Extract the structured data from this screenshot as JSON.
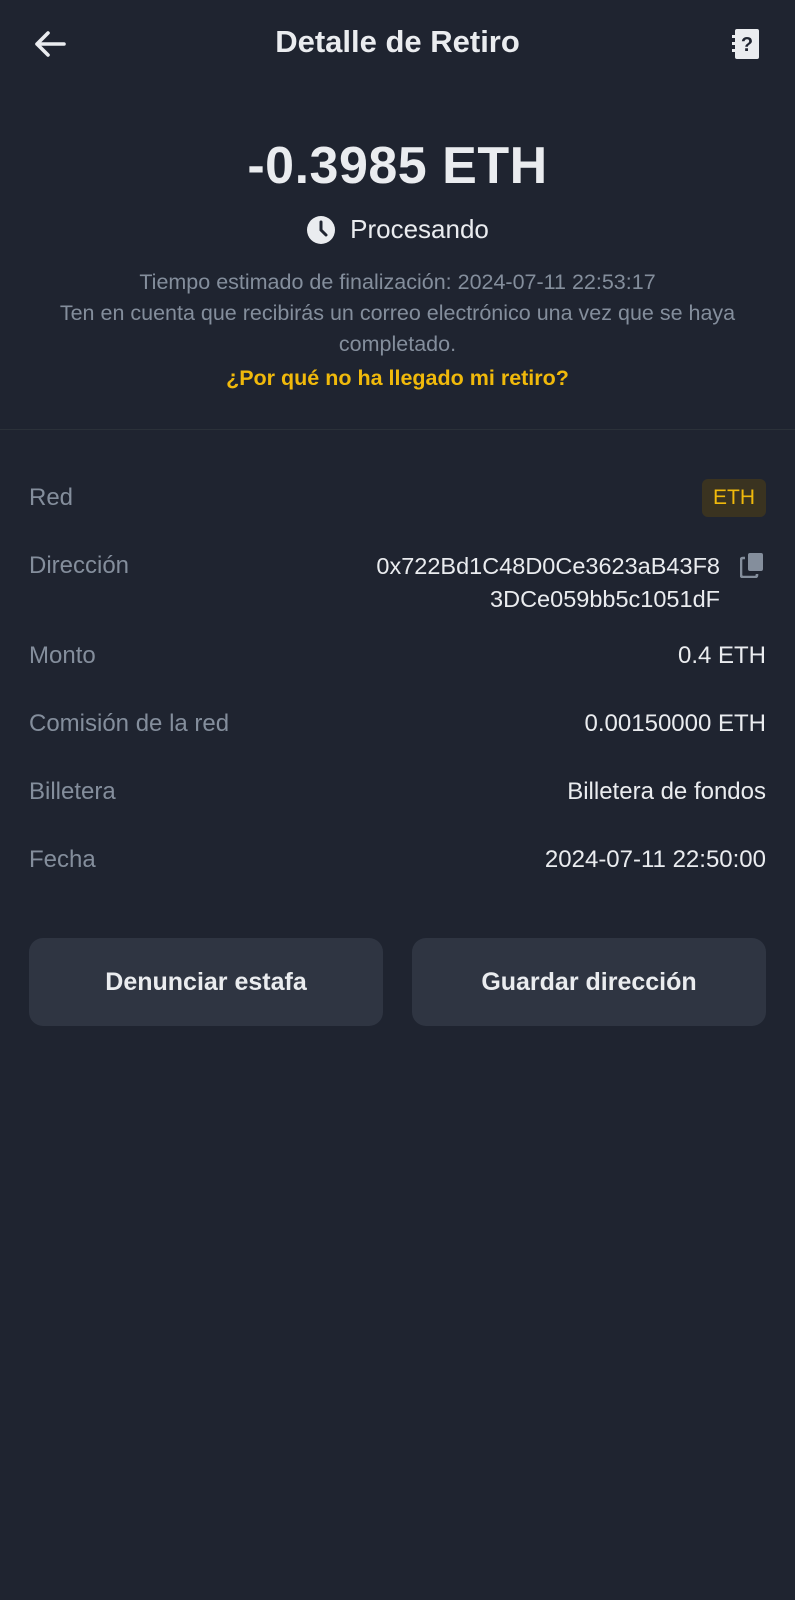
{
  "header": {
    "title": "Detalle de Retiro",
    "back_icon": "arrow-left-icon",
    "help_icon": "help-document-icon"
  },
  "hero": {
    "amount": "-0.3985 ETH",
    "status": "Procesando",
    "status_icon": "clock-icon",
    "estimated_time": "Tiempo estimado de finalización: 2024-07-11 22:53:17",
    "email_note": "Ten en cuenta que recibirás un correo electrónico una vez que se haya completado.",
    "why_link": "¿Por qué no ha llegado mi retiro?"
  },
  "details": {
    "network": {
      "label": "Red",
      "value": "ETH"
    },
    "address": {
      "label": "Dirección",
      "line1": "0x722Bd1C48D0Ce3623aB43F8",
      "line2": "3DCe059bb5c1051dF",
      "copy_icon": "copy-icon"
    },
    "amount": {
      "label": "Monto",
      "value": "0.4 ETH"
    },
    "fee": {
      "label": "Comisión de la red",
      "value": "0.00150000 ETH"
    },
    "wallet": {
      "label": "Billetera",
      "value": "Billetera de fondos"
    },
    "date": {
      "label": "Fecha",
      "value": "2024-07-11 22:50:00"
    }
  },
  "actions": {
    "report_label": "Denunciar estafa",
    "save_label": "Guardar dirección"
  },
  "colors": {
    "background": "#1f2430",
    "accent": "#f0b90b",
    "muted_text": "#848e9c",
    "button_bg": "#2f3542"
  }
}
